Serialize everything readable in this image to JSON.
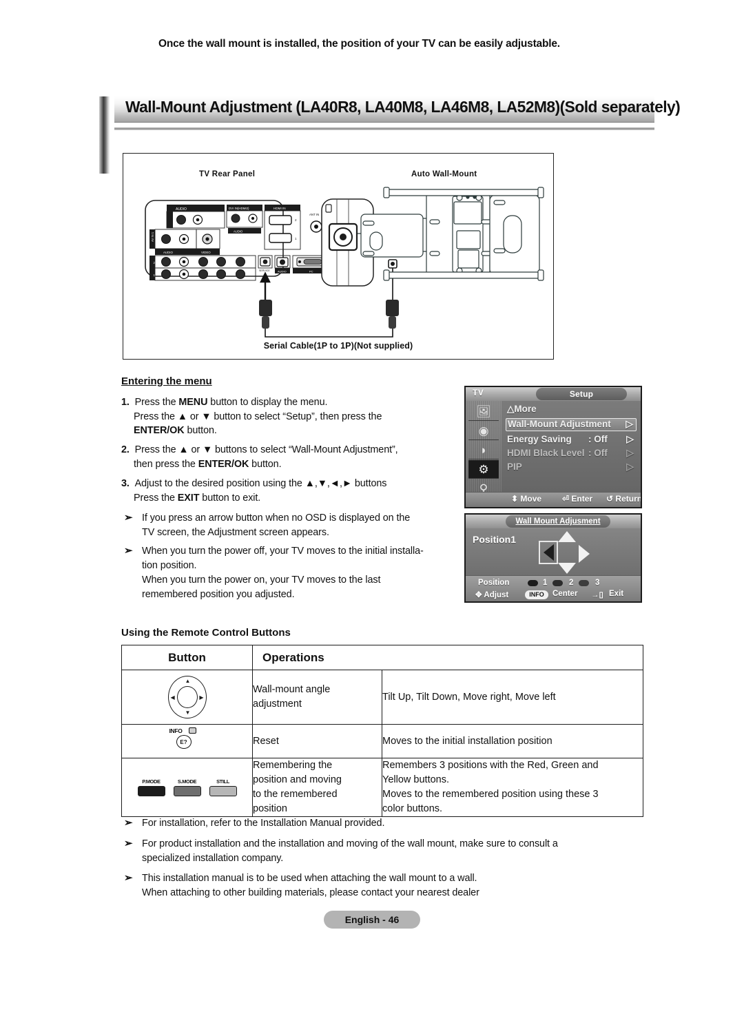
{
  "page": {
    "title": "Wall-Mount Adjustment (LA40R8, LA40M8, LA46M8, LA52M8)(Sold separately)",
    "subtitle": "Once the wall mount is installed, the position of your TV can be easily adjustable.",
    "footer": "English - 46"
  },
  "diagram": {
    "left_label": "TV Rear Panel",
    "right_label": "Auto Wall-Mount",
    "caption": "Serial Cable(1P to 1P)(Not supplied)",
    "panel_ports": [
      "AUDIO OUT",
      "AUDIO",
      "DVI IN(HDMI2)",
      "HDMI IN",
      "ANT IN",
      "AV IN 1",
      "VIDEO",
      "SERVICE",
      "AUDIO",
      "PC",
      "PC IN"
    ]
  },
  "menu_section": {
    "heading": "Entering the menu",
    "steps": [
      {
        "num": "1.",
        "lines": [
          "Press the MENU button to display the menu.",
          "Press the ▲ or ▼ button to select “Setup”, then press the",
          "ENTER/OK button."
        ]
      },
      {
        "num": "2.",
        "lines": [
          "Press the ▲ or ▼ buttons to select “Wall-Mount Adjustment”,",
          "then press the ENTER/OK button."
        ]
      },
      {
        "num": "3.",
        "lines": [
          "Adjust to the desired position using the ▲,▼,◄,► buttons",
          "Press the EXIT button to exit."
        ]
      }
    ],
    "notes": [
      "If you press an arrow button when no OSD is displayed on the TV screen, the Adjustment screen appears.",
      "When you turn the power off, your TV moves to the initial installa-tion position. When you turn the power on, your TV moves to the last remembered position you adjusted."
    ],
    "note1_lines": [
      "If you press an arrow button when no OSD is displayed on the",
      "TV screen, the Adjustment screen appears."
    ],
    "note2_lines": [
      "When you turn the power off, your TV moves to the initial installa-",
      "tion position.",
      "When you turn the power on, your TV moves to the last",
      "remembered position you adjusted."
    ]
  },
  "osd_setup": {
    "tv_label": "TV",
    "tab_label": "Setup",
    "more_label": "△More",
    "rows": [
      {
        "label": "Wall-Mount Adjustment",
        "value": "",
        "arrow": "▷",
        "state": "highlighted"
      },
      {
        "label": "Energy Saving",
        "value": ": Off",
        "arrow": "▷",
        "state": "normal"
      },
      {
        "label": "HDMI Black Level",
        "value": ": Off",
        "arrow": "▷",
        "state": "dim"
      },
      {
        "label": "PIP",
        "value": "",
        "arrow": "▷",
        "state": "dim"
      }
    ],
    "sidebar_icons": [
      "picture-icon",
      "sound-icon",
      "channel-icon",
      "setup-gear-icon",
      "input-icon"
    ],
    "hints": [
      {
        "icon": "↕",
        "label": "Move"
      },
      {
        "icon": "↵",
        "label": "Enter"
      },
      {
        "icon": "↶",
        "label": "Return"
      }
    ]
  },
  "osd_wallmount": {
    "tab_label": "Wall Mount Adjusment",
    "position_label": "Position1",
    "bottom": {
      "position_word": "Position",
      "slots": [
        "1",
        "2",
        "3"
      ],
      "adjust_label": "Adjust",
      "info_label": "INFO",
      "center_label": "Center",
      "exit_label": "Exit"
    }
  },
  "remote_table": {
    "heading": "Using the Remote Control Buttons",
    "columns": [
      "Button",
      "Operations"
    ],
    "rows": [
      {
        "button_icon": "direction-wheel-icon",
        "operation": "Wall-mount angle\nadjustment",
        "operation_lines": [
          "Wall-mount angle",
          "adjustment"
        ],
        "description": "Tilt Up, Tilt Down, Move right,  Move left",
        "description_lines": [
          "Tilt Up, Tilt Down, Move right,  Move left"
        ]
      },
      {
        "button_icon": "info-button-icon",
        "button_caption": "INFO",
        "operation": "Reset",
        "operation_lines": [
          "Reset"
        ],
        "description": "Moves to the initial installation position",
        "description_lines": [
          "Moves to the initial installation position"
        ]
      },
      {
        "button_icon": "mode-buttons-icon",
        "mode_buttons": [
          {
            "caption": "P.MODE",
            "color": "#1c1c1c"
          },
          {
            "caption": "S.MODE",
            "color": "#6e6e6e"
          },
          {
            "caption": "STILL",
            "color": "#b6b6b6"
          }
        ],
        "operation": "Remembering the position and moving to the remembered position",
        "operation_lines": [
          "Remembering the",
          "position and moving",
          "to the remembered",
          "position"
        ],
        "description": "Remembers 3 positions with the Red, Green and Yellow buttons. Moves to the remembered position using these 3 color buttons.",
        "description_lines": [
          "Remembers 3 positions with the Red, Green and",
          "Yellow buttons.",
          "Moves to the remembered position using these 3",
          "color buttons."
        ]
      }
    ]
  },
  "bottom_notes": [
    {
      "lines": [
        "For installation, refer to the Installation Manual provided."
      ]
    },
    {
      "lines": [
        "For product installation and the installation and moving of the wall mount, make sure to consult a",
        "specialized installation company."
      ]
    },
    {
      "lines": [
        "This installation manual is to be used when attaching the wall mount to a wall.",
        "When attaching to other building materials, please contact your nearest dealer"
      ]
    }
  ]
}
